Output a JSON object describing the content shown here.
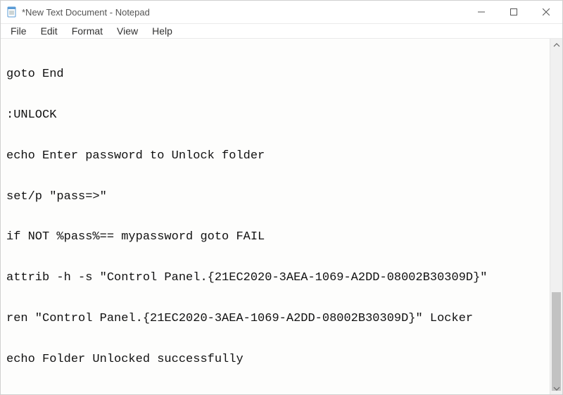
{
  "titlebar": {
    "title": "*New Text Document - Notepad"
  },
  "menu": {
    "file": "File",
    "edit": "Edit",
    "format": "Format",
    "view": "View",
    "help": "Help"
  },
  "editor": {
    "content": "\ngoto End\n\n:UNLOCK\n\necho Enter password to Unlock folder\n\nset/p \"pass=>\"\n\nif NOT %pass%== mypassword goto FAIL\n\nattrib -h -s \"Control Panel.{21EC2020-3AEA-1069-A2DD-08002B30309D}\"\n\nren \"Control Panel.{21EC2020-3AEA-1069-A2DD-08002B30309D}\" Locker\n\necho Folder Unlocked successfully\n\ngoto End\n\n:FAIL"
  }
}
